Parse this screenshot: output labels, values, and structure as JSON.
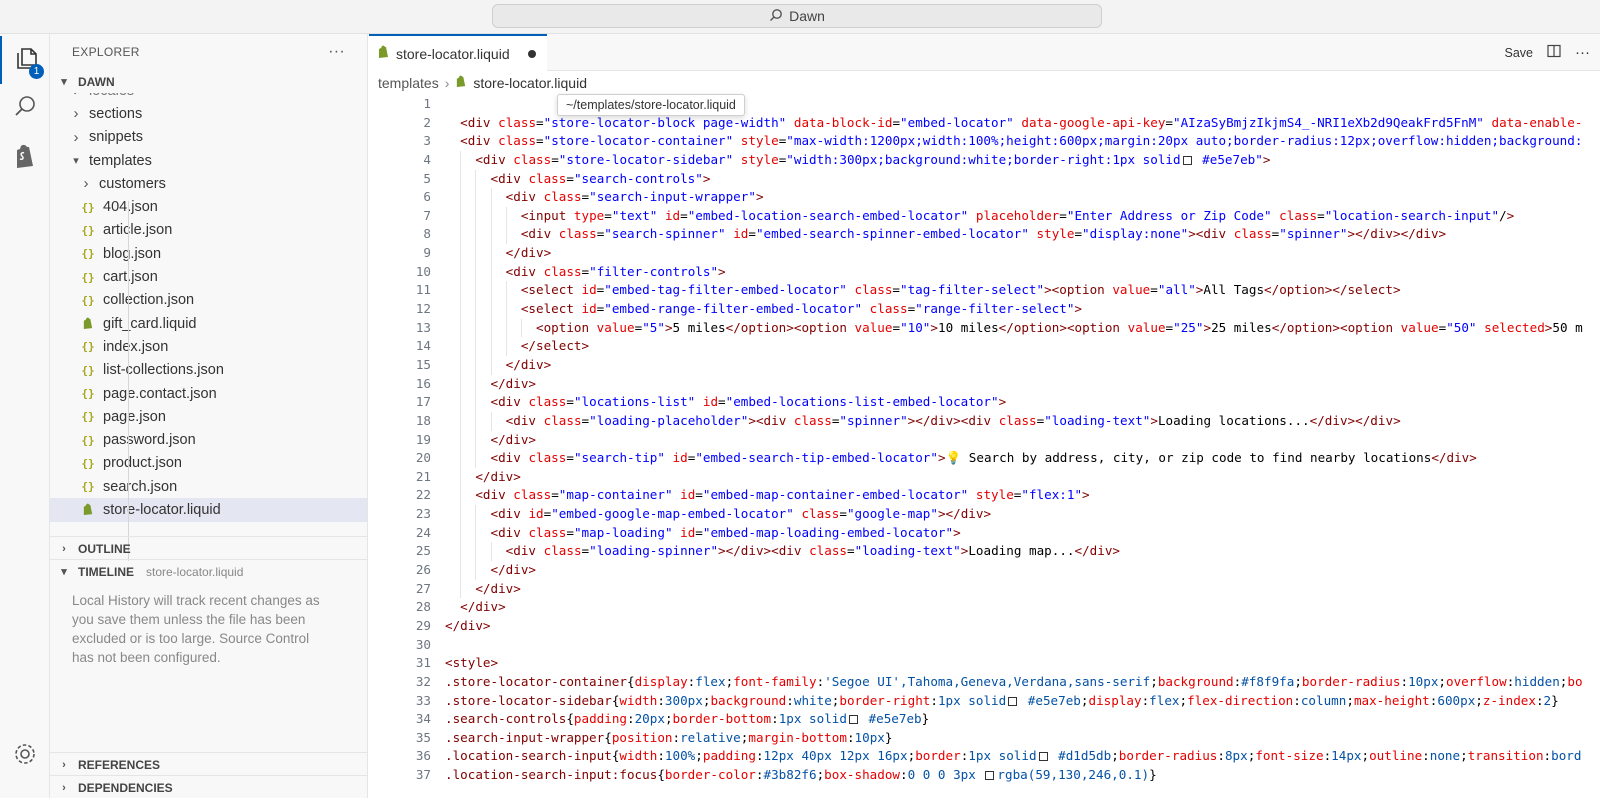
{
  "titlebar": {
    "search_label": "Dawn"
  },
  "activity": {
    "explorer_badge": "1"
  },
  "sidebar": {
    "header": "EXPLORER",
    "workspace": "DAWN",
    "tree": [
      {
        "label": "locales",
        "kind": "folder",
        "depth": 1,
        "partial": true
      },
      {
        "label": "sections",
        "kind": "folder",
        "depth": 1
      },
      {
        "label": "snippets",
        "kind": "folder",
        "depth": 1
      },
      {
        "label": "templates",
        "kind": "folder-open",
        "depth": 1
      },
      {
        "label": "customers",
        "kind": "folder",
        "depth": 2
      },
      {
        "label": "404.json",
        "kind": "json",
        "depth": 2
      },
      {
        "label": "article.json",
        "kind": "json",
        "depth": 2
      },
      {
        "label": "blog.json",
        "kind": "json",
        "depth": 2
      },
      {
        "label": "cart.json",
        "kind": "json",
        "depth": 2
      },
      {
        "label": "collection.json",
        "kind": "json",
        "depth": 2
      },
      {
        "label": "gift_card.liquid",
        "kind": "liquid",
        "depth": 2
      },
      {
        "label": "index.json",
        "kind": "json",
        "depth": 2
      },
      {
        "label": "list-collections.json",
        "kind": "json",
        "depth": 2
      },
      {
        "label": "page.contact.json",
        "kind": "json",
        "depth": 2
      },
      {
        "label": "page.json",
        "kind": "json",
        "depth": 2
      },
      {
        "label": "password.json",
        "kind": "json",
        "depth": 2
      },
      {
        "label": "product.json",
        "kind": "json",
        "depth": 2
      },
      {
        "label": "search.json",
        "kind": "json",
        "depth": 2
      },
      {
        "label": "store-locator.liquid",
        "kind": "liquid",
        "depth": 2,
        "selected": true
      }
    ],
    "outline": "OUTLINE",
    "timeline": "TIMELINE",
    "timeline_file": "store-locator.liquid",
    "timeline_message": "Local History will track recent changes as you save them unless the file has been excluded or is too large. Source Control has not been configured.",
    "references": "REFERENCES",
    "dependencies": "DEPENDENCIES"
  },
  "editor": {
    "tab_label": "store-locator.liquid",
    "save_label": "Save",
    "breadcrumb_folder": "templates",
    "breadcrumb_file": "store-locator.liquid",
    "tooltip": "~/templates/store-locator.liquid"
  },
  "code_lines": [
    "",
    "  <div class=\"store-locator-block page-width\" data-block-id=\"embed-locator\" data-google-api-key=\"AIzaSyBmjzIkjmS4_-NRI1eXb2d9QeakFrd5FnM\" data-enable-",
    "  <div class=\"store-locator-container\" style=\"max-width:1200px;width:100%;height:600px;margin:20px auto;border-radius:12px;overflow:hidden;background:",
    "    <div class=\"store-locator-sidebar\" style=\"width:300px;background:white;border-right:1px solid□ #e5e7eb\">",
    "      <div class=\"search-controls\">",
    "        <div class=\"search-input-wrapper\">",
    "          <input type=\"text\" id=\"embed-location-search-embed-locator\" placeholder=\"Enter Address or Zip Code\" class=\"location-search-input\"/>",
    "          <div class=\"search-spinner\" id=\"embed-search-spinner-embed-locator\" style=\"display:none\"><div class=\"spinner\"></div></div>",
    "        </div>",
    "        <div class=\"filter-controls\">",
    "          <select id=\"embed-tag-filter-embed-locator\" class=\"tag-filter-select\"><option value=\"all\">All Tags</option></select>",
    "          <select id=\"embed-range-filter-embed-locator\" class=\"range-filter-select\">",
    "            <option value=\"5\">5 miles</option><option value=\"10\">10 miles</option><option value=\"25\">25 miles</option><option value=\"50\" selected>50 m",
    "          </select>",
    "        </div>",
    "      </div>",
    "      <div class=\"locations-list\" id=\"embed-locations-list-embed-locator\">",
    "        <div class=\"loading-placeholder\"><div class=\"spinner\"></div><div class=\"loading-text\">Loading locations...</div></div>",
    "      </div>",
    "      <div class=\"search-tip\" id=\"embed-search-tip-embed-locator\">💡 Search by address, city, or zip code to find nearby locations</div>",
    "    </div>",
    "    <div class=\"map-container\" id=\"embed-map-container-embed-locator\" style=\"flex:1\">",
    "      <div id=\"embed-google-map-embed-locator\" class=\"google-map\"></div>",
    "      <div class=\"map-loading\" id=\"embed-map-loading-embed-locator\">",
    "        <div class=\"loading-spinner\"></div><div class=\"loading-text\">Loading map...</div>",
    "      </div>",
    "    </div>",
    "  </div>",
    "</div>",
    "",
    "<style>",
    ".store-locator-container{display:flex;font-family:'Segoe UI',Tahoma,Geneva,Verdana,sans-serif;background:#f8f9fa;border-radius:10px;overflow:hidden;bo",
    ".store-locator-sidebar{width:300px;background:white;border-right:1px solid□ #e5e7eb;display:flex;flex-direction:column;max-height:600px;z-index:2}",
    ".search-controls{padding:20px;border-bottom:1px solid□ #e5e7eb}",
    ".search-input-wrapper{position:relative;margin-bottom:10px}",
    ".location-search-input{width:100%;padding:12px 40px 12px 16px;border:1px solid□ #d1d5db;border-radius:8px;font-size:14px;outline:none;transition:bord",
    ".location-search-input:focus{border-color:#3b82f6;box-shadow:0 0 0 3px □rgba(59,130,246,0.1)}"
  ]
}
